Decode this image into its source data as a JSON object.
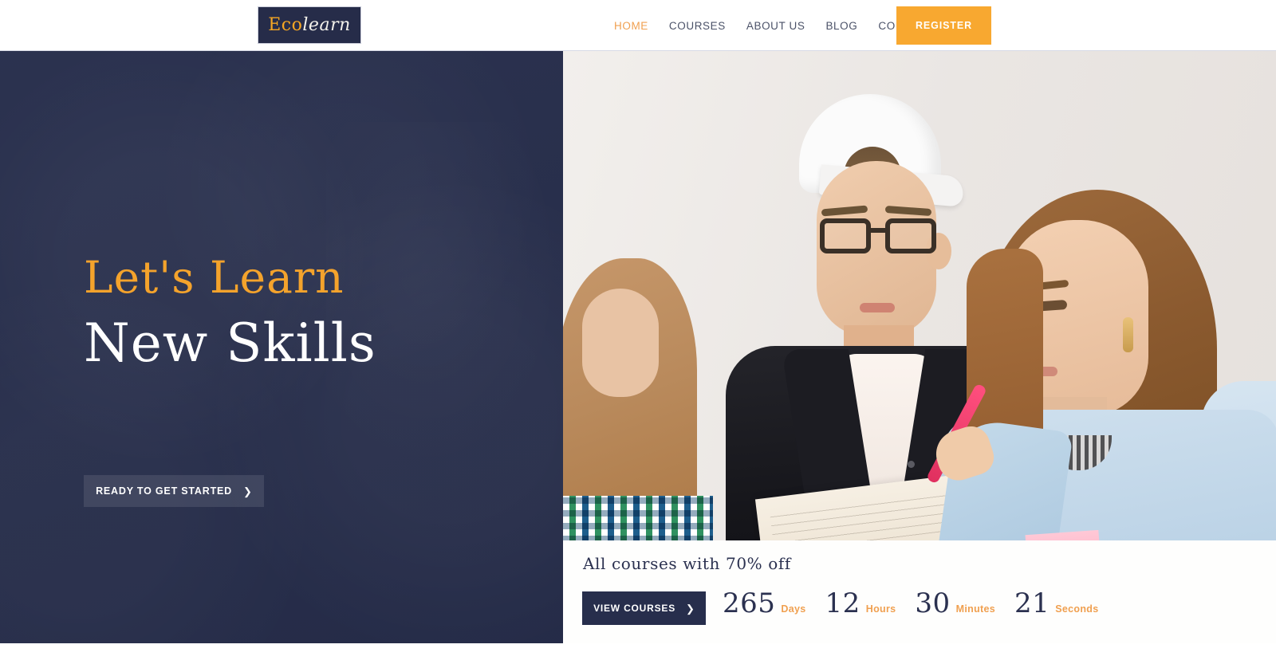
{
  "header": {
    "logo": {
      "part1": "Eco",
      "part2": "learn"
    },
    "nav": [
      {
        "label": "HOME",
        "active": true
      },
      {
        "label": "COURSES",
        "active": false
      },
      {
        "label": "ABOUT US",
        "active": false
      },
      {
        "label": "BLOG",
        "active": false
      },
      {
        "label": "CONTACT US",
        "active": false
      }
    ],
    "register_label": "REGISTER"
  },
  "hero": {
    "headline_line1": "Let's Learn",
    "headline_line2": "New Skills",
    "cta_label": "READY TO GET STARTED",
    "cta_icon": "chevron-right-icon"
  },
  "offer": {
    "title": "All courses with 70% off",
    "button_label": "VIEW COURSES",
    "button_icon": "chevron-right-icon",
    "countdown": [
      {
        "value": "265",
        "unit": "Days"
      },
      {
        "value": "12",
        "unit": "Hours"
      },
      {
        "value": "30",
        "unit": "Minutes"
      },
      {
        "value": "21",
        "unit": "Seconds"
      }
    ]
  },
  "colors": {
    "navy": "#272e4c",
    "orange": "#f5a32e",
    "accent_text": "#f0a050",
    "white": "#ffffff"
  }
}
